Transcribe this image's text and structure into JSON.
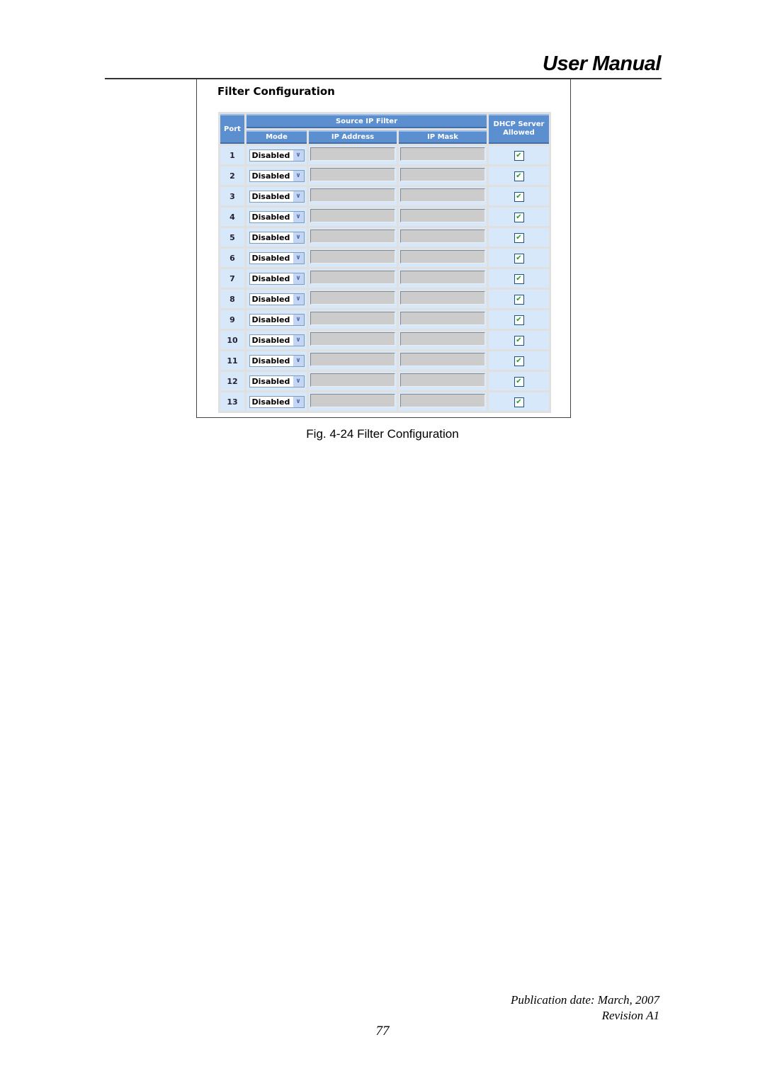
{
  "header": {
    "title": "User Manual"
  },
  "screenshot": {
    "title": "Filter Configuration",
    "table": {
      "headers": {
        "port": "Port",
        "group": "Source IP Filter",
        "mode": "Mode",
        "ip_address": "IP Address",
        "ip_mask": "IP Mask",
        "dhcp": "DHCP Server Allowed"
      },
      "rows": [
        {
          "port": "1",
          "mode": "Disabled",
          "ip_address": "",
          "ip_mask": "",
          "dhcp_allowed": true
        },
        {
          "port": "2",
          "mode": "Disabled",
          "ip_address": "",
          "ip_mask": "",
          "dhcp_allowed": true
        },
        {
          "port": "3",
          "mode": "Disabled",
          "ip_address": "",
          "ip_mask": "",
          "dhcp_allowed": true
        },
        {
          "port": "4",
          "mode": "Disabled",
          "ip_address": "",
          "ip_mask": "",
          "dhcp_allowed": true
        },
        {
          "port": "5",
          "mode": "Disabled",
          "ip_address": "",
          "ip_mask": "",
          "dhcp_allowed": true
        },
        {
          "port": "6",
          "mode": "Disabled",
          "ip_address": "",
          "ip_mask": "",
          "dhcp_allowed": true
        },
        {
          "port": "7",
          "mode": "Disabled",
          "ip_address": "",
          "ip_mask": "",
          "dhcp_allowed": true
        },
        {
          "port": "8",
          "mode": "Disabled",
          "ip_address": "",
          "ip_mask": "",
          "dhcp_allowed": true
        },
        {
          "port": "9",
          "mode": "Disabled",
          "ip_address": "",
          "ip_mask": "",
          "dhcp_allowed": true
        },
        {
          "port": "10",
          "mode": "Disabled",
          "ip_address": "",
          "ip_mask": "",
          "dhcp_allowed": true
        },
        {
          "port": "11",
          "mode": "Disabled",
          "ip_address": "",
          "ip_mask": "",
          "dhcp_allowed": true
        },
        {
          "port": "12",
          "mode": "Disabled",
          "ip_address": "",
          "ip_mask": "",
          "dhcp_allowed": true
        },
        {
          "port": "13",
          "mode": "Disabled",
          "ip_address": "",
          "ip_mask": "",
          "dhcp_allowed": true
        }
      ]
    }
  },
  "caption": "Fig. 4-24 Filter Configuration",
  "footer": {
    "publication": "Publication date: March, 2007",
    "revision": "Revision A1",
    "page_number": "77"
  }
}
